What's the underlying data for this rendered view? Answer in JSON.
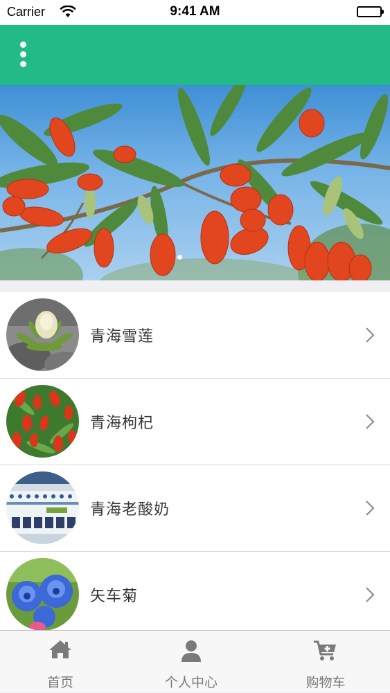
{
  "status_bar": {
    "carrier": "Carrier",
    "time": "9:41 AM",
    "icons": [
      "wifi-icon",
      "battery-icon"
    ]
  },
  "nav_bar": {
    "color": "#22bb88",
    "menu_icon": "more-vertical-icon"
  },
  "banner": {
    "description_icon": "goji-berry-photo",
    "page_indicator": {
      "count": 1,
      "current": 1
    }
  },
  "list": {
    "items": [
      {
        "label": "青海雪莲",
        "image": "snow-lotus-photo"
      },
      {
        "label": "青海枸杞",
        "image": "goji-berry-photo"
      },
      {
        "label": "青海老酸奶",
        "image": "yogurt-jar-photo"
      },
      {
        "label": "矢车菊",
        "image": "cornflower-photo"
      }
    ],
    "chevron_icon": "chevron-right-icon"
  },
  "tab_bar": {
    "tabs": [
      {
        "label": "首页",
        "icon": "home-icon"
      },
      {
        "label": "个人中心",
        "icon": "user-icon"
      },
      {
        "label": "购物车",
        "icon": "cart-add-icon"
      }
    ]
  }
}
